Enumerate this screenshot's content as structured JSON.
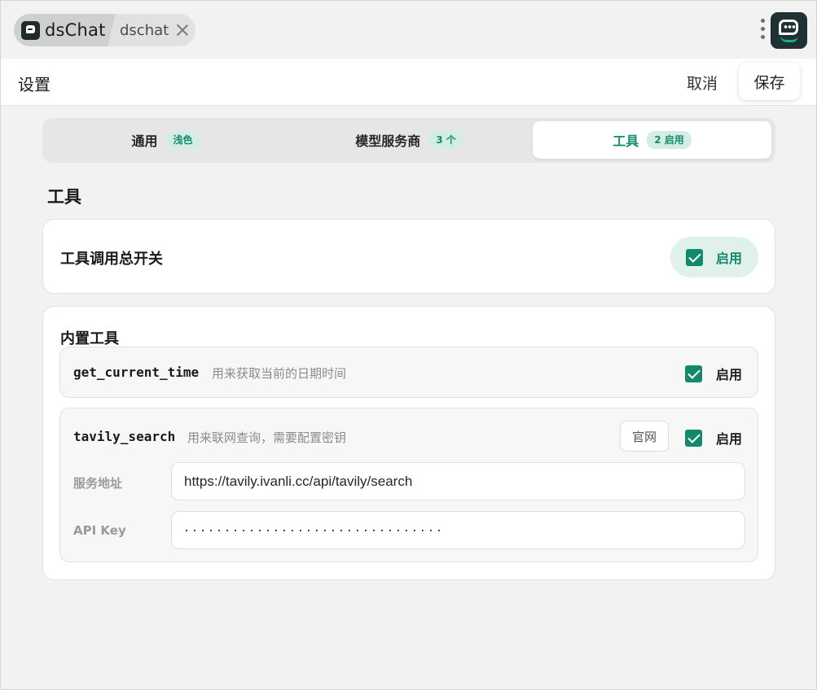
{
  "topbar": {
    "app_name": "dsChat",
    "page_name": "dschat"
  },
  "header": {
    "title": "设置",
    "cancel_label": "取消",
    "save_label": "保存"
  },
  "tabs": [
    {
      "label": "通用",
      "badge": "浅色",
      "active": false
    },
    {
      "label": "模型服务商",
      "badge": "3 个",
      "active": false
    },
    {
      "label": "工具",
      "badge": "2 启用",
      "active": true
    }
  ],
  "section_title": "工具",
  "master_switch": {
    "label": "工具调用总开关",
    "checked": true,
    "state_label": "启用"
  },
  "builtin": {
    "title": "内置工具",
    "tools": [
      {
        "name": "get_current_time",
        "description": "用来获取当前的日期时间",
        "checked": true,
        "state_label": "启用"
      },
      {
        "name": "tavily_search",
        "description": "用来联网查询，需要配置密钥",
        "site_label": "官网",
        "checked": true,
        "state_label": "启用",
        "service_url_label": "服务地址",
        "service_url_value": "https://tavily.ivanli.cc/api/tavily/search",
        "api_key_label": "API Key",
        "api_key_value": "································"
      }
    ]
  },
  "colors": {
    "accent": "#13896b",
    "accent_bg": "#dff1ea",
    "badge_bg": "#d3ede4"
  }
}
